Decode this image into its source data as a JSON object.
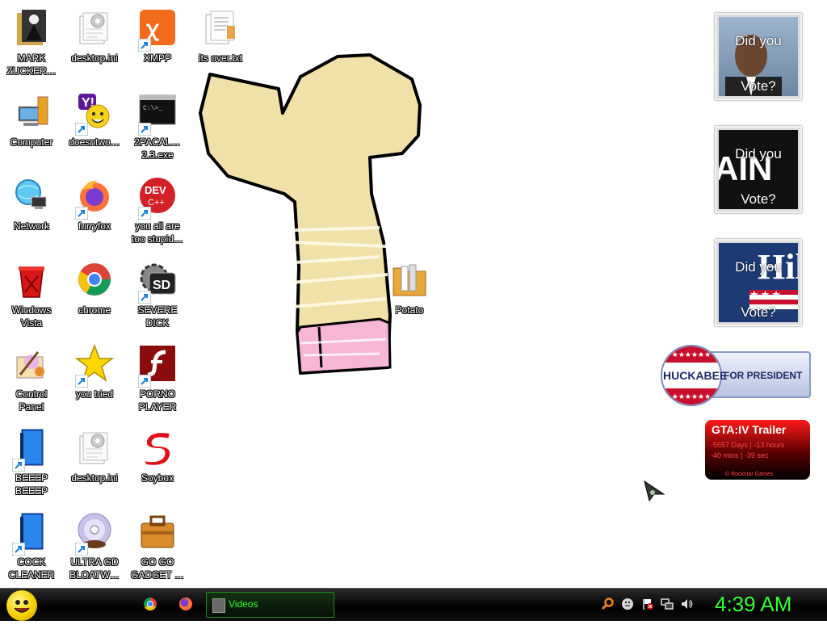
{
  "desktop": {
    "icons": [
      {
        "name": "mark-zuckerberg",
        "label": "MARK\nZUCKER…",
        "col": 0,
        "row": 0,
        "icon": "person-file-icon",
        "shortcut": false
      },
      {
        "name": "computer",
        "label": "Computer",
        "col": 0,
        "row": 1,
        "icon": "computer-icon",
        "shortcut": false
      },
      {
        "name": "network",
        "label": "Network",
        "col": 0,
        "row": 2,
        "icon": "network-globe-icon",
        "shortcut": false
      },
      {
        "name": "windows-vista",
        "label": "Windows\nVista",
        "col": 0,
        "row": 3,
        "icon": "recycle-bin-icon",
        "shortcut": false
      },
      {
        "name": "control-panel",
        "label": "Control\nPanel",
        "col": 0,
        "row": 4,
        "icon": "control-panel-icon",
        "shortcut": false
      },
      {
        "name": "beeep-beeep",
        "label": "BEEEP\nBEEEP",
        "col": 0,
        "row": 5,
        "icon": "blue-book-icon",
        "shortcut": true
      },
      {
        "name": "cock-cleaner",
        "label": "COCK\nCLEANER",
        "col": 0,
        "row": 6,
        "icon": "blue-book-icon",
        "shortcut": true
      },
      {
        "name": "desktop-ini-1",
        "label": "desktop.ini",
        "col": 1,
        "row": 0,
        "icon": "settings-file-icon",
        "shortcut": false
      },
      {
        "name": "doesntwo",
        "label": "doesntwo…",
        "col": 1,
        "row": 1,
        "icon": "yahoo-messenger-icon",
        "shortcut": true
      },
      {
        "name": "furryfox",
        "label": "furryfox",
        "col": 1,
        "row": 2,
        "icon": "firefox-icon",
        "shortcut": true
      },
      {
        "name": "chrome",
        "label": "chrome",
        "col": 1,
        "row": 3,
        "icon": "chrome-icon",
        "shortcut": false
      },
      {
        "name": "you-tried",
        "label": "you tried",
        "col": 1,
        "row": 4,
        "icon": "star-icon",
        "shortcut": true
      },
      {
        "name": "desktop-ini-2",
        "label": "desktop.ini",
        "col": 1,
        "row": 5,
        "icon": "settings-file-icon",
        "shortcut": false
      },
      {
        "name": "ultra-gd-bloatw",
        "label": "ULTRA GD\nBLOATW…",
        "col": 1,
        "row": 6,
        "icon": "dvd-icon",
        "shortcut": true
      },
      {
        "name": "xmpp",
        "label": "XMPP",
        "col": 2,
        "row": 0,
        "icon": "xampp-icon",
        "shortcut": true
      },
      {
        "name": "2pacal",
        "label": "2PACAL…\n2.3.exe",
        "col": 2,
        "row": 1,
        "icon": "cmd-icon",
        "shortcut": true
      },
      {
        "name": "you-all-are-too-stupid",
        "label": "you all are\ntoo stupid…",
        "col": 2,
        "row": 2,
        "icon": "dev-cpp-icon",
        "shortcut": true
      },
      {
        "name": "severe-dick",
        "label": "SEVERE\nDICK",
        "col": 2,
        "row": 3,
        "icon": "sd-gear-icon",
        "shortcut": true
      },
      {
        "name": "porno-player",
        "label": "PORNO\nPLAYER",
        "col": 2,
        "row": 4,
        "icon": "flash-icon",
        "shortcut": true
      },
      {
        "name": "soybox",
        "label": "Soybox",
        "col": 2,
        "row": 5,
        "icon": "soybox-s-icon",
        "shortcut": false
      },
      {
        "name": "go-go-gadget",
        "label": "GO GO\nGADGET …",
        "col": 2,
        "row": 6,
        "icon": "briefcase-icon",
        "shortcut": false
      },
      {
        "name": "its-over-txt",
        "label": "its over.txt",
        "col": 3,
        "row": 0,
        "icon": "text-document-icon",
        "shortcut": false
      },
      {
        "name": "potato",
        "label": "Potato",
        "col": "potato",
        "row": "potato",
        "icon": "folder-icon",
        "shortcut": false
      }
    ]
  },
  "gadgets": {
    "vote1": {
      "line1": "Did you",
      "line2": "Vote?"
    },
    "vote2": {
      "line1": "Did you",
      "line2": "Vote?",
      "banner": "AIN"
    },
    "vote3": {
      "line1": "Did you",
      "line2": "Vote?",
      "banner": "Hil"
    },
    "huckabee": {
      "name": "HUCKABEE",
      "tagline": "FOR PRESIDENT"
    },
    "gta": {
      "title": "GTA:IV  Trailer",
      "line1": "-5557 Days | -13 hours",
      "line2": "-40 mins | -39 sec",
      "footer": "© Rockstar Games"
    }
  },
  "taskbar": {
    "window_label": "Videos",
    "clock": "4:39 AM",
    "pinned": [
      "chrome-icon",
      "firefox-icon"
    ],
    "tray": [
      "search-icon",
      "messenger-icon",
      "flag-icon",
      "network-icon",
      "volume-icon"
    ]
  },
  "colors": {
    "clock": "#33ff33",
    "taskbar": "#000000",
    "drawing_fill": "#f0e1a8",
    "drawing_pink": "#f7b6d6"
  }
}
